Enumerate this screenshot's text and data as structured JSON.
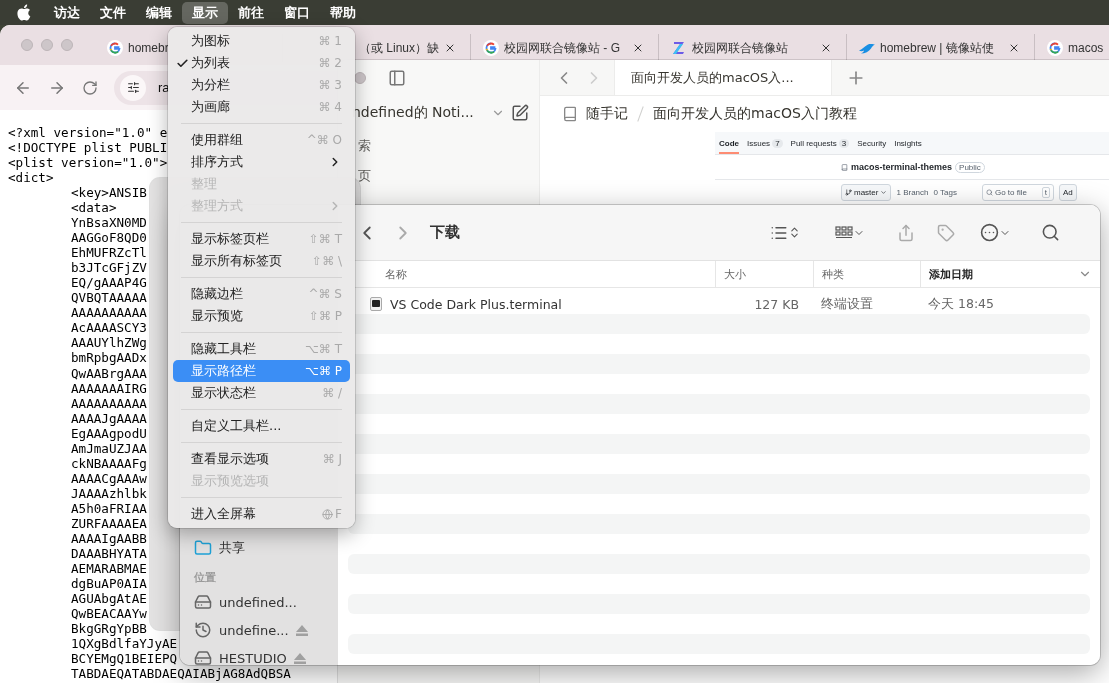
{
  "menu_bar": {
    "items": [
      {
        "label": "访达",
        "selected": false
      },
      {
        "label": "文件",
        "selected": false
      },
      {
        "label": "编辑",
        "selected": false
      },
      {
        "label": "显示",
        "selected": true
      },
      {
        "label": "前往",
        "selected": false
      },
      {
        "label": "窗口",
        "selected": false
      },
      {
        "label": "帮助",
        "selected": false
      }
    ]
  },
  "browser": {
    "tabs": [
      {
        "kind": "google",
        "title": "homebr"
      },
      {
        "kind": "covered",
        "title": "（或 Linux）缺"
      },
      {
        "kind": "google",
        "title": "校园网联合镜像站 - G"
      },
      {
        "kind": "mirror",
        "title": "校园网联合镜像站"
      },
      {
        "kind": "bird",
        "title": "homebrew | 镜像站使"
      },
      {
        "kind": "google",
        "title": "macos"
      }
    ],
    "address": "ra",
    "source": [
      {
        "text": "<?xml version=\"1.0\" e"
      },
      {
        "text": "<!DOCTYPE plist PUBLI"
      },
      {
        "text": "<plist version=\"1.0\">"
      },
      {
        "text": "<dict>",
        "children": [
          {
            "text": "<key>ANSIB"
          },
          {
            "text": "<data>"
          },
          {
            "text": "YnBsaXN0MD"
          },
          {
            "text": "AAGGoF8QD0"
          },
          {
            "text": "EhMUFRZcTl"
          },
          {
            "text": "b3JTcGFjZV"
          },
          {
            "text": "EQ/gAAAP4G"
          },
          {
            "text": "QVBQTAAAAA"
          },
          {
            "text": "AAAAAAAAAA"
          },
          {
            "text": "AcAAAASCY3"
          },
          {
            "text": "AAAUYlhZWg"
          },
          {
            "text": "bmRpbgAADx"
          },
          {
            "text": "QwAABrgAAA"
          },
          {
            "text": "AAAAAAAIRG"
          },
          {
            "text": "AAAAAAAAAA"
          },
          {
            "text": "AAAAJgAAAA"
          },
          {
            "text": "EgAAAgpodU"
          },
          {
            "text": "AmJmaUZJAA"
          },
          {
            "text": "ckNBAAAAFg"
          },
          {
            "text": "AAAACgAAAw"
          },
          {
            "text": "JAAAAzhlbk"
          },
          {
            "text": "A5h0aFRIAA"
          },
          {
            "text": "ZURFAAAAEA"
          },
          {
            "text": "AAAAIgAABB"
          },
          {
            "text": "DAAABHYATA"
          },
          {
            "text": "AEMARABMAE"
          },
          {
            "text": "dgBuAP0AIA"
          },
          {
            "text": "AGUAbgAtAE"
          },
          {
            "text": "QwBEACAAYw"
          },
          {
            "text": "BkgGRgYpBB"
          },
          {
            "text": "1QXgBdlfaYJyAE"
          },
          {
            "text": "BCYEMgQ1BEIEPQ"
          },
          {
            "text": "TABDAEQATABDAEQAIABjAG8AdQBSA"
          }
        ]
      }
    ]
  },
  "notes_app": {
    "workspace": "ndefined的 Noti...",
    "sidebar_items": [
      "索",
      "页"
    ],
    "tab": "面向开发人员的macOS入...",
    "breadcrumb": [
      "随手记",
      "面向开发人员的macOS入门教程"
    ],
    "embedded_screenshot": {
      "nav": [
        {
          "label": "Code",
          "selected": true
        },
        {
          "label": "Issues",
          "count": "7",
          "selected": false
        },
        {
          "label": "Pull requests",
          "count": "3",
          "selected": false
        },
        {
          "label": "Security",
          "selected": false
        },
        {
          "label": "Insights",
          "selected": false
        }
      ],
      "repo": "macos-terminal-themes",
      "visibility": "Public",
      "branch": "master",
      "branches": "1 Branch",
      "tags": "0 Tags",
      "search_placeholder": "Go to file",
      "search_key": "t",
      "button": "Ad"
    }
  },
  "finder": {
    "title": "下载",
    "sidebar": [
      {
        "kind": "shared",
        "label": "共享",
        "eject": false
      },
      {
        "kind": "header",
        "label": "位置"
      },
      {
        "kind": "drive",
        "label": "undefined...",
        "eject": false
      },
      {
        "kind": "timemachine",
        "label": "undefine...",
        "eject": true
      },
      {
        "kind": "external",
        "label": "HESTUDIO",
        "eject": true
      }
    ],
    "columns": [
      {
        "label": "名称",
        "sorted": false
      },
      {
        "label": "大小",
        "sorted": false
      },
      {
        "label": "种类",
        "sorted": false
      },
      {
        "label": "添加日期",
        "sorted": true
      }
    ],
    "rows": [
      {
        "name": "VS Code Dark Plus.terminal",
        "size": "127 KB",
        "type": "终端设置",
        "date_added": "今天 18:45"
      }
    ]
  },
  "view_menu": {
    "items": [
      {
        "kind": "item",
        "label": "为图标",
        "shortcut": "⌘ 1",
        "checked": false,
        "disabled": false,
        "selected": false,
        "submenu": false
      },
      {
        "kind": "item",
        "label": "为列表",
        "shortcut": "⌘ 2",
        "checked": true,
        "disabled": false,
        "selected": false,
        "submenu": false
      },
      {
        "kind": "item",
        "label": "为分栏",
        "shortcut": "⌘ 3",
        "checked": false,
        "disabled": false,
        "selected": false,
        "submenu": false
      },
      {
        "kind": "item",
        "label": "为画廊",
        "shortcut": "⌘ 4",
        "checked": false,
        "disabled": false,
        "selected": false,
        "submenu": false
      },
      {
        "kind": "separator"
      },
      {
        "kind": "item",
        "label": "使用群组",
        "shortcut": "^⌘ O",
        "checked": false,
        "disabled": false,
        "selected": false,
        "submenu": false
      },
      {
        "kind": "item",
        "label": "排序方式",
        "checked": false,
        "disabled": false,
        "selected": false,
        "submenu": true
      },
      {
        "kind": "item",
        "label": "整理",
        "checked": false,
        "disabled": true,
        "selected": false,
        "submenu": false
      },
      {
        "kind": "item",
        "label": "整理方式",
        "checked": false,
        "disabled": true,
        "selected": false,
        "submenu": true
      },
      {
        "kind": "separator"
      },
      {
        "kind": "item",
        "label": "显示标签页栏",
        "shortcut": "⇧⌘ T",
        "checked": false,
        "disabled": false,
        "selected": false,
        "submenu": false
      },
      {
        "kind": "item",
        "label": "显示所有标签页",
        "shortcut": "⇧⌘ \\",
        "checked": false,
        "disabled": false,
        "selected": false,
        "submenu": false
      },
      {
        "kind": "separator"
      },
      {
        "kind": "item",
        "label": "隐藏边栏",
        "shortcut": "^⌘ S",
        "checked": false,
        "disabled": false,
        "selected": false,
        "submenu": false
      },
      {
        "kind": "item",
        "label": "显示预览",
        "shortcut": "⇧⌘ P",
        "checked": false,
        "disabled": false,
        "selected": false,
        "submenu": false
      },
      {
        "kind": "separator"
      },
      {
        "kind": "item",
        "label": "隐藏工具栏",
        "shortcut": "⌥⌘ T",
        "checked": false,
        "disabled": false,
        "selected": false,
        "submenu": false
      },
      {
        "kind": "item",
        "label": "显示路径栏",
        "shortcut": "⌥⌘ P",
        "checked": false,
        "disabled": false,
        "selected": true,
        "submenu": false
      },
      {
        "kind": "item",
        "label": "显示状态栏",
        "shortcut": "⌘ /",
        "checked": false,
        "disabled": false,
        "selected": false,
        "submenu": false
      },
      {
        "kind": "separator"
      },
      {
        "kind": "item",
        "label": "自定义工具栏...",
        "checked": false,
        "disabled": false,
        "selected": false,
        "submenu": false
      },
      {
        "kind": "separator"
      },
      {
        "kind": "item",
        "label": "查看显示选项",
        "shortcut": "⌘ J",
        "checked": false,
        "disabled": false,
        "selected": false,
        "submenu": false
      },
      {
        "kind": "item",
        "label": "显示预览选项",
        "checked": false,
        "disabled": true,
        "selected": false,
        "submenu": false
      },
      {
        "kind": "separator"
      },
      {
        "kind": "item",
        "label": "进入全屏幕",
        "shortcut": "F",
        "globe_key": true,
        "checked": false,
        "disabled": false,
        "selected": false,
        "submenu": false
      }
    ]
  }
}
